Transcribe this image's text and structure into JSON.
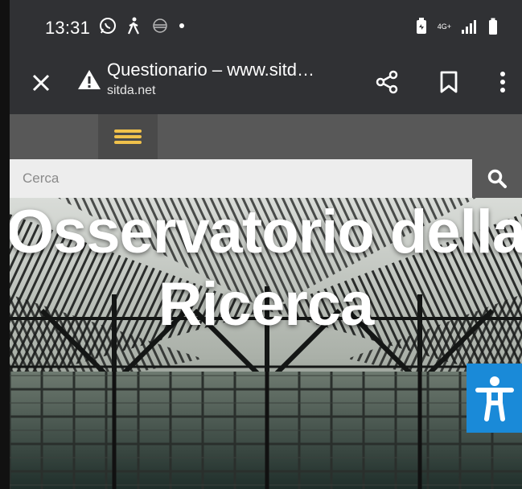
{
  "status": {
    "time": "13:31",
    "network": "4G+"
  },
  "toolbar": {
    "title": "Questionario – www.sitd…",
    "url": "sitda.net"
  },
  "search": {
    "placeholder": "Cerca"
  },
  "hero": {
    "line1": "Osservatorio della",
    "line2": "Ricerca"
  },
  "icons": {
    "close": "close-icon",
    "warning": "warning-icon",
    "share": "share-icon",
    "bookmark": "bookmark-icon",
    "more": "more-vert-icon",
    "menu": "hamburger-icon",
    "search": "search-icon",
    "accessibility": "accessibility-icon"
  },
  "colors": {
    "chrome": "#303134",
    "nav": "#585858",
    "menu_accent": "#f0c14b",
    "accessibility": "#1a8ad8"
  }
}
